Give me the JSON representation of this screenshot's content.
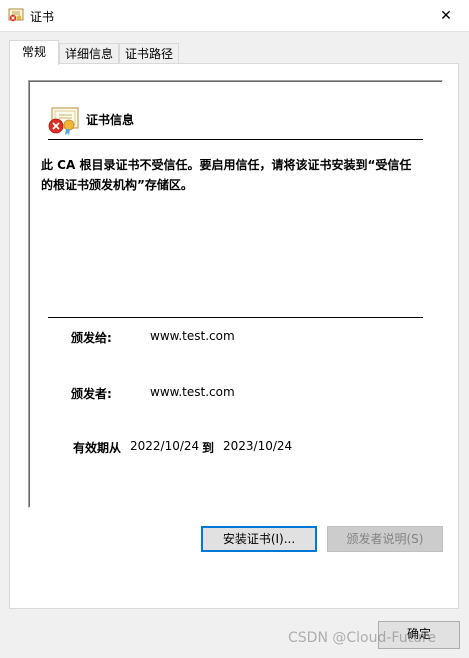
{
  "window": {
    "title": "证书",
    "close_glyph": "✕"
  },
  "tabs": [
    {
      "label": "常规",
      "active": true
    },
    {
      "label": "详细信息",
      "active": false
    },
    {
      "label": "证书路径",
      "active": false
    }
  ],
  "cert_info": {
    "heading": "证书信息",
    "warning": "此 CA 根目录证书不受信任。要启用信任，请将该证书安装到“受信任的根证书颁发机构”存储区。",
    "issued_to_label": "颁发给:",
    "issued_to": "www.test.com",
    "issued_by_label": "颁发者:",
    "issued_by": "www.test.com",
    "valid_from_label": "有效期从",
    "valid_from": "2022/10/24",
    "valid_to_label": "到",
    "valid_to": "2023/10/24"
  },
  "buttons": {
    "install": "安装证书(I)...",
    "issuer_statement": "颁发者说明(S)",
    "ok": "确定"
  },
  "watermark": "CSDN @Cloud-Future",
  "colors": {
    "focus_border": "#0078d7",
    "error_red": "#d93025"
  }
}
